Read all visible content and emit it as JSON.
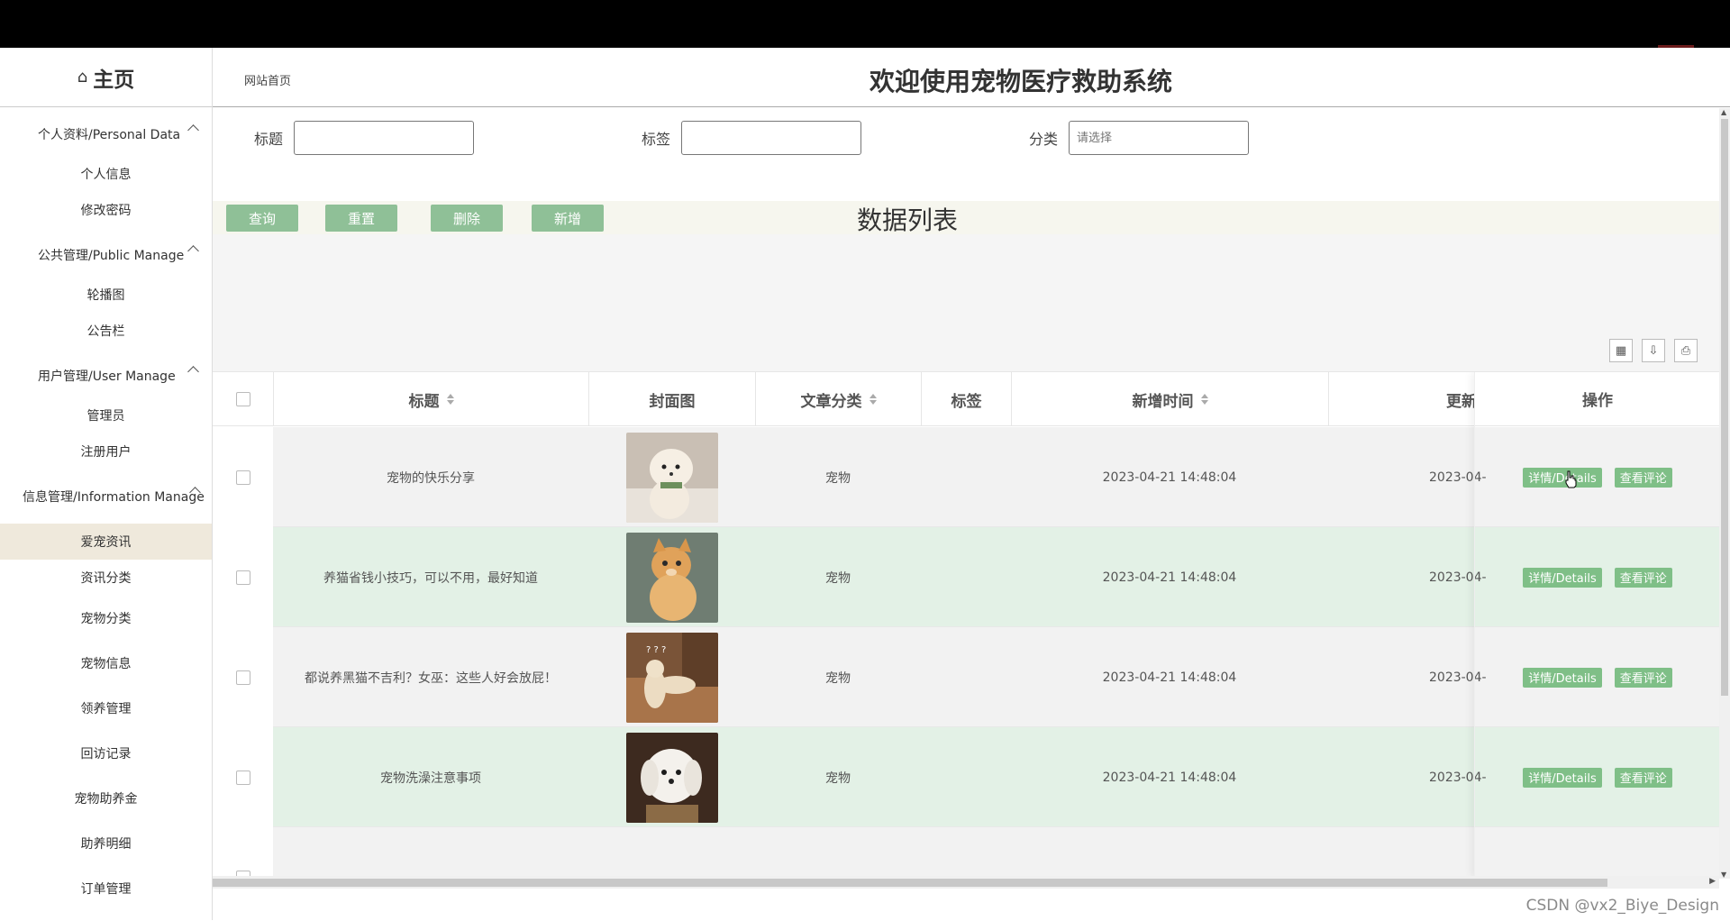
{
  "nav": {
    "home": "主页",
    "groups": [
      {
        "title": "个人资料/Personal Data",
        "items": [
          "个人信息",
          "修改密码"
        ]
      },
      {
        "title": "公共管理/Public Manage",
        "items": [
          "轮播图",
          "公告栏"
        ]
      },
      {
        "title": "用户管理/User Manage",
        "items": [
          "管理员",
          "注册用户"
        ]
      },
      {
        "title": "信息管理/Information Manage",
        "items": [
          "爱宠资讯",
          "资讯分类",
          "宠物分类",
          "宠物信息",
          "领养管理",
          "回访记录",
          "宠物助养金",
          "助养明细",
          "订单管理"
        ]
      }
    ],
    "active_item": "爱宠资讯"
  },
  "header": {
    "breadcrumb": "网站首页",
    "title": "欢迎使用宠物医疗救助系统"
  },
  "search": {
    "title_label": "标题",
    "tag_label": "标签",
    "category_label": "分类",
    "category_placeholder": "请选择"
  },
  "actions": {
    "query": "查询",
    "reset": "重置",
    "delete": "删除",
    "add": "新增"
  },
  "list_title": "数据列表",
  "table": {
    "columns": [
      "标题",
      "封面图",
      "文章分类",
      "标签",
      "新增时间",
      "更新",
      "操作"
    ],
    "rows": [
      {
        "title": "宠物的快乐分享",
        "category": "宠物",
        "tag": "",
        "created": "2023-04-21 14:48:04",
        "updated": "2023-04-",
        "image": "dog-white"
      },
      {
        "title": "养猫省钱小技巧，可以不用，最好知道",
        "category": "宠物",
        "tag": "",
        "created": "2023-04-21 14:48:04",
        "updated": "2023-04-",
        "image": "cat-orange"
      },
      {
        "title": "都说养黑猫不吉利？女巫：这些人好会放屁！",
        "category": "宠物",
        "tag": "",
        "created": "2023-04-21 14:48:04",
        "updated": "2023-04-",
        "image": "cat-cream"
      },
      {
        "title": "宠物洗澡注意事项",
        "category": "宠物",
        "tag": "",
        "created": "2023-04-21 14:48:04",
        "updated": "2023-04-",
        "image": "dog-fluffy"
      }
    ],
    "details_btn": "详情/Details",
    "comments_btn": "查看评论"
  },
  "watermark": "CSDN @vx2_Biye_Design",
  "colors": {
    "button_green": "#8fc097",
    "row_alt": "#e3f1e6",
    "active_nav": "#efe9dc"
  }
}
